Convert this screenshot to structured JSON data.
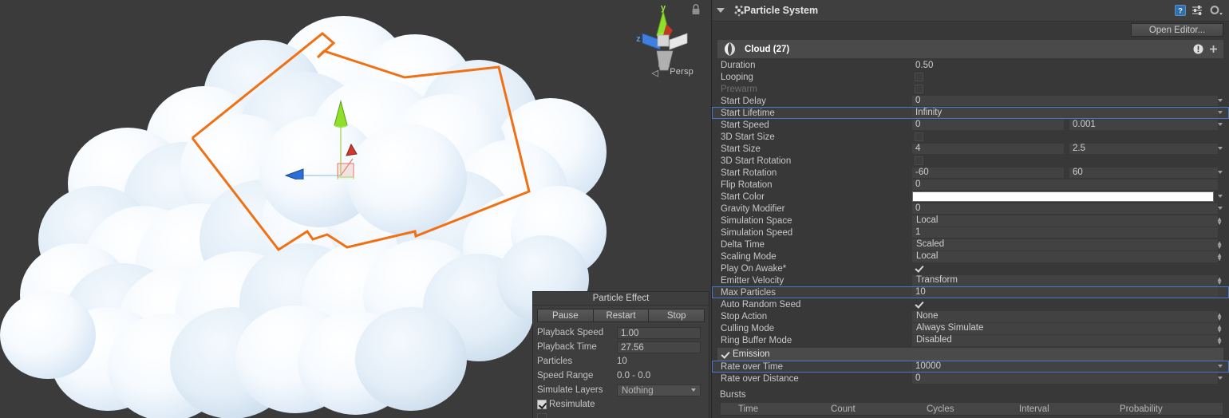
{
  "scene": {
    "gizmo": {
      "y_axis_label": "y",
      "z_axis_label": "z",
      "persp_label": "Persp",
      "persp_arrow": "◁",
      "lock_icon": "lock-icon"
    }
  },
  "particle_effect": {
    "title": "Particle Effect",
    "buttons": [
      "Pause",
      "Restart",
      "Stop"
    ],
    "rows": [
      {
        "label": "Playback Speed",
        "value": "1.00",
        "kind": "field"
      },
      {
        "label": "Playback Time",
        "value": "27.56",
        "kind": "field"
      },
      {
        "label": "Particles",
        "value": "10",
        "kind": "text"
      },
      {
        "label": "Speed Range",
        "value": "0.0 - 0.0",
        "kind": "text"
      },
      {
        "label": "Simulate Layers",
        "value": "Nothing",
        "kind": "popup"
      }
    ],
    "checks": [
      {
        "label": "Resimulate",
        "checked": true
      },
      {
        "label": "",
        "checked": false
      }
    ]
  },
  "inspector": {
    "title": "Particle System",
    "open_editor_label": "Open Editor...",
    "header_icons": [
      "help-icon",
      "preset-icon",
      "gear-icon"
    ],
    "component": {
      "name": "Cloud (27)",
      "icon": "particle-system-icon",
      "warning_icon": "warning-icon",
      "add_icon": "+"
    },
    "properties": [
      {
        "label": "Duration",
        "kind": "plain",
        "value": "0.50"
      },
      {
        "label": "Looping",
        "kind": "checkbox_off"
      },
      {
        "label": "Prewarm",
        "kind": "checkbox_off",
        "disabled": true
      },
      {
        "label": "Start Delay",
        "kind": "single",
        "value": "0",
        "arrow": true
      },
      {
        "label": "Start Lifetime",
        "kind": "single",
        "value": "Infinity",
        "arrow": true,
        "selected": true
      },
      {
        "label": "Start Speed",
        "kind": "dual",
        "value": "0",
        "value2": "0.001",
        "arrow": true
      },
      {
        "label": "3D Start Size",
        "kind": "checkbox_off"
      },
      {
        "label": "Start Size",
        "kind": "dual",
        "value": "4",
        "value2": "2.5",
        "arrow": true
      },
      {
        "label": "3D Start Rotation",
        "kind": "checkbox_off"
      },
      {
        "label": "Start Rotation",
        "kind": "dual",
        "value": "-60",
        "value2": "60",
        "arrow": true
      },
      {
        "label": "Flip Rotation",
        "kind": "single",
        "value": "0"
      },
      {
        "label": "Start Color",
        "kind": "color",
        "value": "#ffffff",
        "arrow": true
      },
      {
        "label": "Gravity Modifier",
        "kind": "single",
        "value": "0",
        "arrow": true
      },
      {
        "label": "Simulation Space",
        "kind": "popup",
        "value": "Local"
      },
      {
        "label": "Simulation Speed",
        "kind": "single",
        "value": "1"
      },
      {
        "label": "Delta Time",
        "kind": "popup",
        "value": "Scaled"
      },
      {
        "label": "Scaling Mode",
        "kind": "popup",
        "value": "Local"
      },
      {
        "label": "Play On Awake*",
        "kind": "checkbox_on"
      },
      {
        "label": "Emitter Velocity",
        "kind": "popup",
        "value": "Transform"
      },
      {
        "label": "Max Particles",
        "kind": "single",
        "value": "10",
        "selected": true
      },
      {
        "label": "Auto Random Seed",
        "kind": "checkbox_on"
      },
      {
        "label": "Stop Action",
        "kind": "popup",
        "value": "None"
      },
      {
        "label": "Culling Mode",
        "kind": "popup",
        "value": "Always Simulate"
      },
      {
        "label": "Ring Buffer Mode",
        "kind": "popup",
        "value": "Disabled"
      }
    ],
    "emission": {
      "label": "Emission",
      "enabled": true,
      "properties": [
        {
          "label": "Rate over Time",
          "kind": "single",
          "value": "10000",
          "arrow": true,
          "selected": true
        },
        {
          "label": "Rate over Distance",
          "kind": "single",
          "value": "0",
          "arrow": true
        }
      ],
      "bursts_label": "Bursts",
      "bursts_columns": [
        "Time",
        "Count",
        "Cycles",
        "Interval",
        "Probability"
      ]
    }
  },
  "colors": {
    "selection_outline": "#f07014",
    "row_selected_border": "#4a78c8",
    "inspector_bg": "#383838",
    "scene_bg": "#3b3b3b",
    "start_color_swatch": "#ffffff",
    "axis_y": "#8ee02a",
    "axis_z": "#3f7fe0",
    "axis_x": "#d13b2a"
  }
}
